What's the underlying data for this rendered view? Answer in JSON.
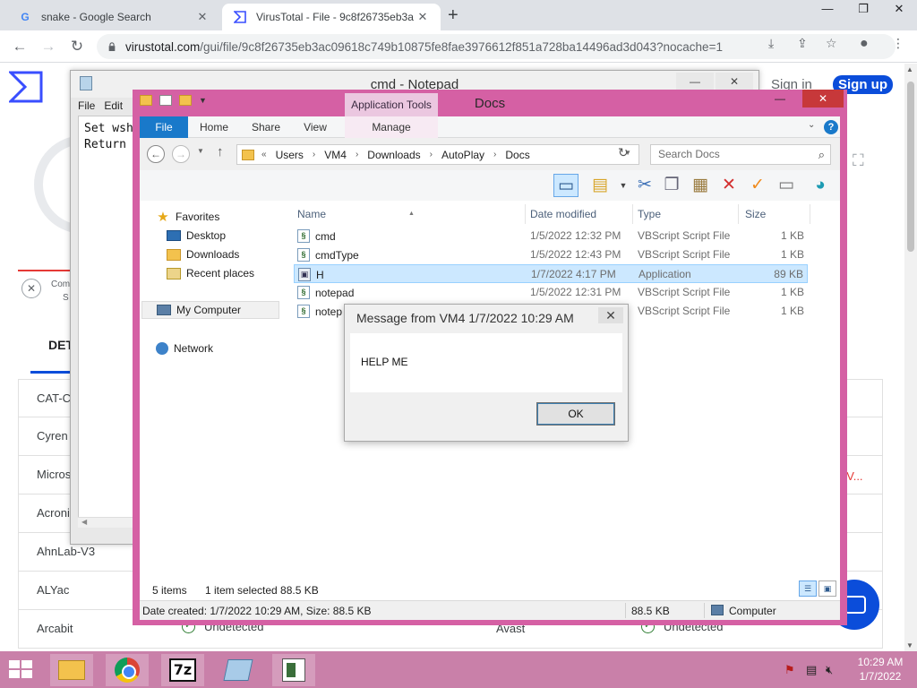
{
  "browser": {
    "tabs": [
      {
        "title": "snake - Google Search",
        "icon": "google-icon",
        "active": false
      },
      {
        "title": "VirusTotal - File - 9c8f26735eb3a",
        "icon": "virustotal-icon",
        "active": true
      }
    ],
    "url_host": "virustotal.com",
    "url_path": "/gui/file/9c8f26735eb3ac09618c749b10875fe8fae3976612f851a728ba14496ad3d043?nocache=1"
  },
  "virustotal": {
    "sign_in": "Sign in",
    "sign_up": "Sign up",
    "snippet_com": "Com",
    "snippet_s": "S",
    "detection_tab": "DET",
    "snippet_red": "pV...",
    "rows": [
      {
        "engine": "CAT-C"
      },
      {
        "engine": "Cyren"
      },
      {
        "engine": "Micros"
      },
      {
        "engine": "Acroni"
      },
      {
        "engine": "AhnLab-V3"
      },
      {
        "engine": "ALYac"
      },
      {
        "engine": "Arcabit",
        "result": "Undetected",
        "engine2": "Avast",
        "result2": "Undetected"
      }
    ]
  },
  "notepad": {
    "title": "cmd - Notepad",
    "menu": [
      "File",
      "Edit"
    ],
    "lines": [
      "Set wsh",
      "Return"
    ]
  },
  "explorer": {
    "title": "Docs",
    "context_tab": "Application Tools",
    "ribbon_tabs": [
      "File",
      "Home",
      "Share",
      "View",
      "Manage"
    ],
    "breadcrumb": [
      "Users",
      "VM4",
      "Downloads",
      "AutoPlay",
      "Docs"
    ],
    "search_placeholder": "Search Docs",
    "nav": {
      "favorites": "Favorites",
      "desktop": "Desktop",
      "downloads": "Downloads",
      "recent": "Recent places",
      "my_computer": "My Computer",
      "network": "Network"
    },
    "columns": {
      "name": "Name",
      "date": "Date modified",
      "type": "Type",
      "size": "Size"
    },
    "files": [
      {
        "name": "cmd",
        "date": "1/5/2022 12:32 PM",
        "type": "VBScript Script File",
        "size": "1 KB",
        "selected": false,
        "kind": "script"
      },
      {
        "name": "cmdType",
        "date": "1/5/2022 12:43 PM",
        "type": "VBScript Script File",
        "size": "1 KB",
        "selected": false,
        "kind": "script"
      },
      {
        "name": "H",
        "date": "1/7/2022 4:17 PM",
        "type": "Application",
        "size": "89 KB",
        "selected": true,
        "kind": "app"
      },
      {
        "name": "notepad",
        "date": "1/5/2022 12:31 PM",
        "type": "VBScript Script File",
        "size": "1 KB",
        "selected": false,
        "kind": "script"
      },
      {
        "name": "notep",
        "date": "",
        "type": "VBScript Script File",
        "size": "1 KB",
        "selected": false,
        "kind": "script"
      }
    ],
    "status_items": "5 items",
    "status_selected": "1 item selected  88.5 KB",
    "details_created": "Date created: 1/7/2022 10:29 AM, Size: 88.5 KB",
    "details_size": "88.5 KB",
    "details_location": "Computer"
  },
  "message_box": {
    "title": "Message from VM4 1/7/2022 10:29 AM",
    "text": "HELP ME",
    "ok": "OK"
  },
  "taskbar": {
    "apps": [
      "file-explorer-icon",
      "chrome-icon",
      "7zip-icon",
      "notepad-icon",
      "vbscript-icon"
    ],
    "sevenzip_label": "7z",
    "time": "10:29 AM",
    "date": "1/7/2022"
  }
}
